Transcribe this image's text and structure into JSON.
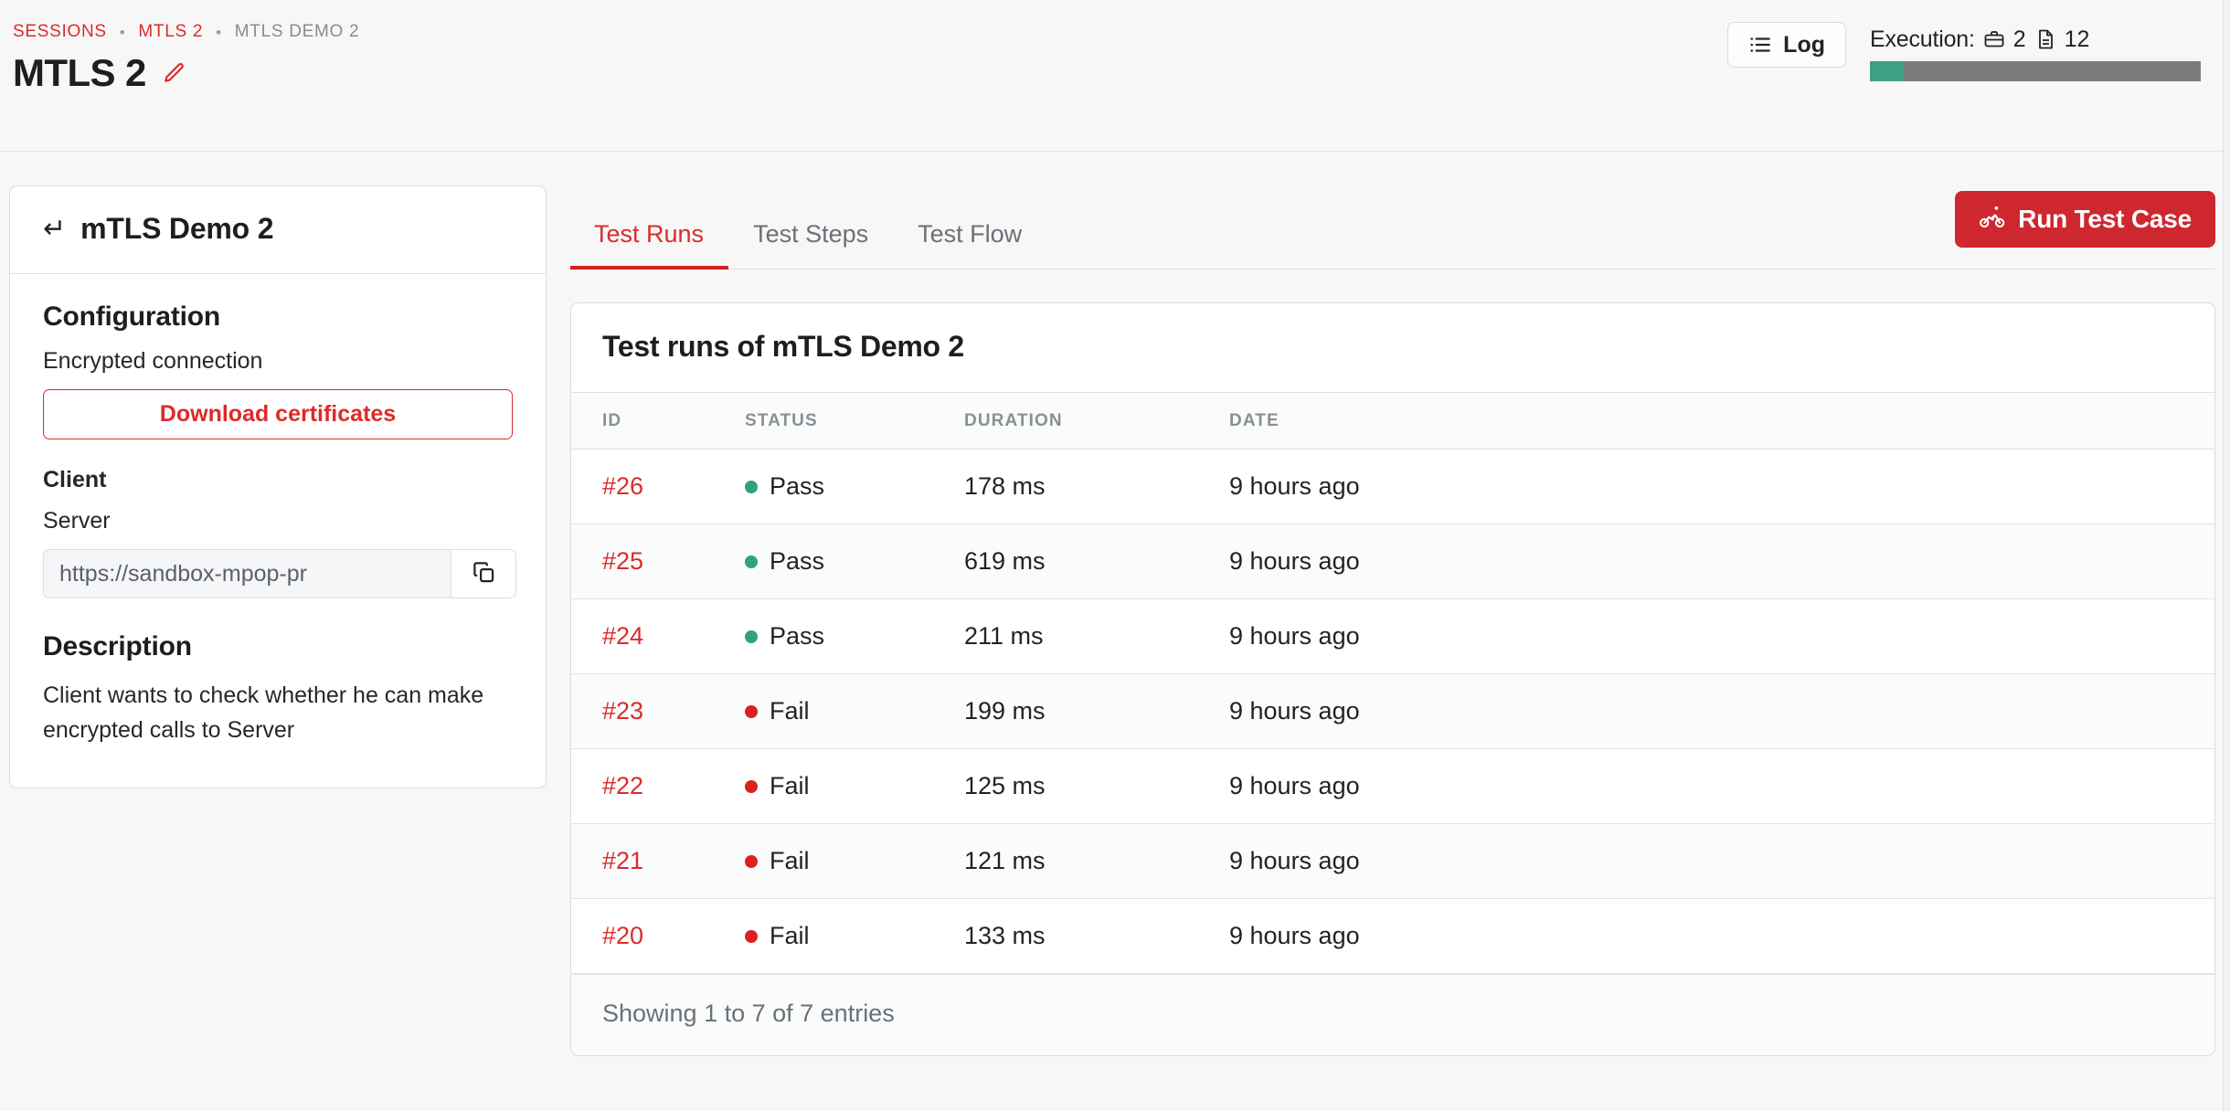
{
  "header": {
    "breadcrumb": [
      {
        "label": "SESSIONS",
        "type": "link"
      },
      {
        "label": "MTLS 2",
        "type": "link"
      },
      {
        "label": "MTLS DEMO 2",
        "type": "current"
      }
    ],
    "separator": "•",
    "title": "MTLS 2",
    "edit_icon": "pencil-icon",
    "log_button": {
      "label": "Log",
      "icon": "list-icon"
    },
    "execution": {
      "label": "Execution:",
      "briefcase_icon": "briefcase-icon",
      "briefcase_count": "2",
      "document_icon": "document-icon",
      "document_count": "12",
      "progress_percent": 10,
      "fill_color": "#3ea184",
      "track_color": "#7c7c7c"
    }
  },
  "sidebar": {
    "card_title": "mTLS Demo 2",
    "return_icon": "↵",
    "configuration": {
      "heading": "Configuration",
      "encrypted_connection_label": "Encrypted connection",
      "download_button": "Download certificates",
      "client_label": "Client",
      "server_label": "Server",
      "server_url_value": "https://sandbox-mpop-pr",
      "server_url_placeholder": "https://sandbox-mpop-pr",
      "copy_icon": "copy-icon"
    },
    "description": {
      "heading": "Description",
      "text": "Client wants to check whether he can make encrypted calls to Server"
    }
  },
  "main": {
    "tabs": [
      {
        "label": "Test Runs",
        "active": true
      },
      {
        "label": "Test Steps",
        "active": false
      },
      {
        "label": "Test Flow",
        "active": false
      }
    ],
    "run_button": {
      "label": "Run Test Case",
      "icon": "person-biking-icon"
    },
    "table": {
      "title": "Test runs of mTLS Demo 2",
      "columns": [
        "ID",
        "STATUS",
        "DURATION",
        "DATE"
      ],
      "rows": [
        {
          "id": "#26",
          "status": "Pass",
          "status_kind": "pass",
          "duration": "178 ms",
          "date": "9 hours ago"
        },
        {
          "id": "#25",
          "status": "Pass",
          "status_kind": "pass",
          "duration": "619 ms",
          "date": "9 hours ago"
        },
        {
          "id": "#24",
          "status": "Pass",
          "status_kind": "pass",
          "duration": "211 ms",
          "date": "9 hours ago"
        },
        {
          "id": "#23",
          "status": "Fail",
          "status_kind": "fail",
          "duration": "199 ms",
          "date": "9 hours ago"
        },
        {
          "id": "#22",
          "status": "Fail",
          "status_kind": "fail",
          "duration": "125 ms",
          "date": "9 hours ago"
        },
        {
          "id": "#21",
          "status": "Fail",
          "status_kind": "fail",
          "duration": "121 ms",
          "date": "9 hours ago"
        },
        {
          "id": "#20",
          "status": "Fail",
          "status_kind": "fail",
          "duration": "133 ms",
          "date": "9 hours ago"
        }
      ],
      "footer": "Showing 1 to 7 of 7 entries"
    }
  },
  "colors": {
    "accent_red": "#dc2b2b",
    "button_red": "#cf2730",
    "pass_green": "#2fa27f",
    "fail_red": "#dc2020",
    "page_bg": "#f7f7f7"
  }
}
